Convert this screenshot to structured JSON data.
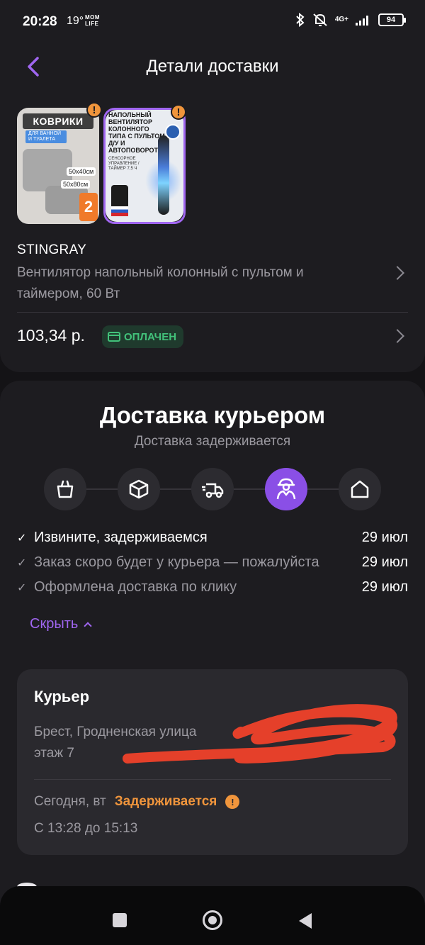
{
  "status_bar": {
    "time": "20:28",
    "temperature": "19°",
    "app_logo_text": "MOM\nLIFE",
    "network": "4G+",
    "battery": "94"
  },
  "header": {
    "title": "Детали доставки"
  },
  "products": [
    {
      "name": "mats",
      "title_text": "КОВРИКИ",
      "sub_text": "ДЛЯ ВАННОЙ И ТУАЛЕТА",
      "size1": "50x40см",
      "size2": "50x80см",
      "badge": "2",
      "warning": true
    },
    {
      "name": "fan",
      "title_text": "НАПОЛЬНЫЙ ВЕНТИЛЯТОР КОЛОННОГО ТИПА С ПУЛЬТОМ Д/У И АВТОПОВОРОТОМ",
      "sub_text": "СЕНСОРНОЕ УПРАВЛЕНИЕ / ТАЙМЕР 7,5 Ч",
      "warning": true,
      "selected": true
    }
  ],
  "order": {
    "seller": "STINGRAY",
    "product_name": "Вентилятор напольный колонный с пультом и таймером, 60 Вт",
    "price": "103,34 р.",
    "status": "ОПЛАЧЕН"
  },
  "delivery": {
    "title": "Доставка курьером",
    "subtitle": "Доставка задерживается",
    "steps": [
      {
        "icon": "shopping-bag-icon",
        "active": false
      },
      {
        "icon": "box-icon",
        "active": false
      },
      {
        "icon": "truck-icon",
        "active": false
      },
      {
        "icon": "courier-icon",
        "active": true
      },
      {
        "icon": "home-icon",
        "active": false
      }
    ],
    "history": [
      {
        "text": "Извините, задерживаемся",
        "date": "29 июл"
      },
      {
        "text": "Заказ скоро будет у курьера — пожалуйста",
        "date": "29 июл"
      },
      {
        "text": "Оформлена доставка по клику",
        "date": "29 июл"
      }
    ],
    "hide_label": "Скрыть"
  },
  "courier": {
    "title": "Курьер",
    "address_line1": "Брест, Гродненская улица",
    "address_line2": "этаж 7",
    "day": "Сегодня, вт",
    "status": "Задерживается",
    "time_window": "С 13:28 до 15:13"
  },
  "colors": {
    "background": "#141316",
    "card": "#1d1c20",
    "accent": "#8a4fe6",
    "warning": "#f0953c",
    "paid_green": "#42c27a"
  }
}
